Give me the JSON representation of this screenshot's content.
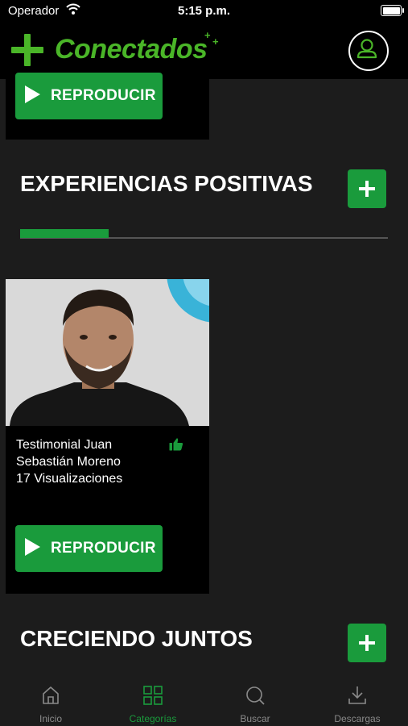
{
  "status_bar": {
    "carrier": "Operador",
    "time": "5:15 p.m."
  },
  "app": {
    "name": "Conectados",
    "accent": "#4ab528",
    "button_color": "#1a9b3c"
  },
  "sections": [
    {
      "title": "EXPERIENCIAS POSITIVAS",
      "video": {
        "title_line1": "Testimonial Juan",
        "title_line2": "Sebastián Moreno",
        "views": "17 Visualizaciones",
        "play_label": "REPRODUCIR"
      }
    },
    {
      "title": "CRECIENDO JUNTOS"
    }
  ],
  "previous_card": {
    "play_label": "REPRODUCIR"
  },
  "carousel_progress": 0.24,
  "tabs": [
    {
      "label": "Inicio",
      "icon": "home-icon"
    },
    {
      "label": "Categorías",
      "icon": "grid-icon",
      "active": true
    },
    {
      "label": "Buscar",
      "icon": "search-icon"
    },
    {
      "label": "Descargas",
      "icon": "download-icon"
    }
  ]
}
